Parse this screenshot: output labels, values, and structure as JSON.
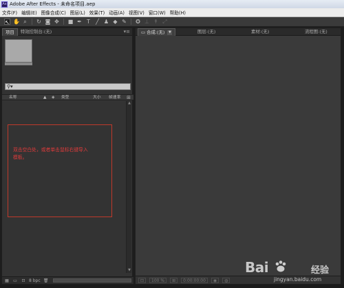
{
  "window": {
    "app_icon": "Ae",
    "title": "Adobe After Effects - 未命名项目.aep"
  },
  "menu": [
    "文件(F)",
    "编辑(E)",
    "图像合成(C)",
    "图层(L)",
    "效果(T)",
    "动画(A)",
    "视图(V)",
    "窗口(W)",
    "帮助(H)"
  ],
  "toolbar": {
    "icons": [
      "selection-tool-icon",
      "hand-tool-icon",
      "zoom-tool-icon",
      "rotate-tool-icon",
      "camera-tool-icon",
      "pan-behind-tool-icon",
      "mask-tool-icon",
      "pen-tool-icon",
      "type-tool-icon",
      "brush-tool-icon",
      "clone-stamp-tool-icon",
      "eraser-tool-icon",
      "roto-brush-tool-icon",
      "puppet-pin-tool-icon"
    ]
  },
  "project_panel": {
    "tab_project": "项目",
    "tab_effect_controls": "特效控制台:(无)",
    "search_icon": "search-icon",
    "columns": {
      "name": "名称",
      "type": "类型",
      "size": "大小",
      "frame_rate": "帧速率"
    },
    "instruction": "双击空白处，或者单击鼠标右键导入模板。",
    "footer_bpc": "8 bpc"
  },
  "composition_panel": {
    "tab_comp": "合成:(无)",
    "tab_layer": "图层:(无)",
    "tab_footage": "素材:(无)",
    "tab_flowchart": "流程图:(无)",
    "zoom": "100 %",
    "timecode": "0:00:00:00"
  },
  "watermark": {
    "logo": "Bai",
    "logo_suffix": "经验",
    "url": "jingyan.baidu.com"
  },
  "colors": {
    "panel_bg": "#333333",
    "annotation": "#e03b3b"
  }
}
